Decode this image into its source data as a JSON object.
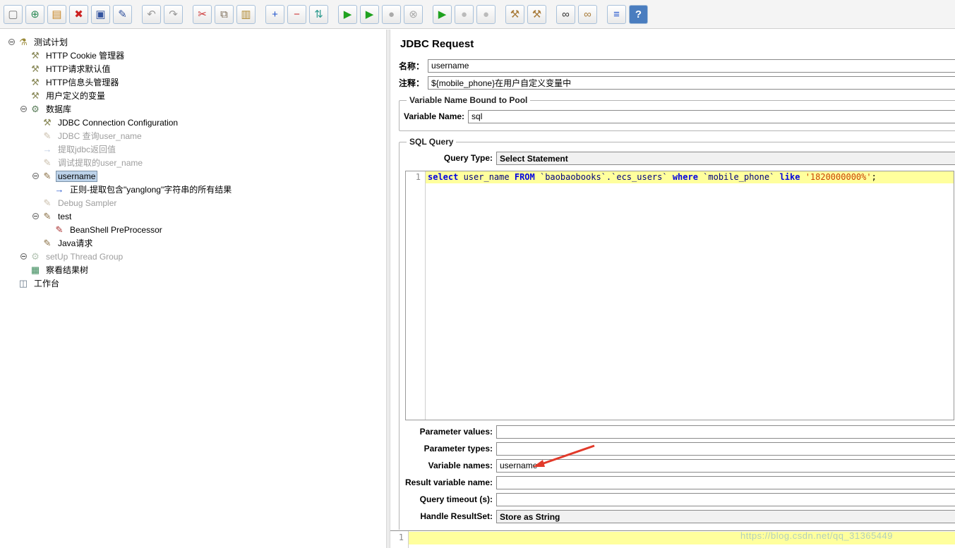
{
  "toolbar": {
    "groups": [
      [
        {
          "name": "new-plan",
          "glyph": "▢",
          "fg": "#777777"
        },
        {
          "name": "templates",
          "glyph": "⊕",
          "fg": "#2e8b57"
        },
        {
          "name": "open-file",
          "glyph": "▤",
          "fg": "#c8882a"
        },
        {
          "name": "close-plan",
          "glyph": "✖",
          "fg": "#cc2222"
        },
        {
          "name": "save",
          "glyph": "▣",
          "fg": "#33539e"
        },
        {
          "name": "save-as",
          "glyph": "✎",
          "fg": "#33539e"
        }
      ],
      [
        {
          "name": "undo",
          "glyph": "↶",
          "fg": "#999999"
        },
        {
          "name": "redo",
          "glyph": "↷",
          "fg": "#999999"
        }
      ],
      [
        {
          "name": "cut",
          "glyph": "✂",
          "fg": "#cc3333"
        },
        {
          "name": "copy",
          "glyph": "⧉",
          "fg": "#7a6a55"
        },
        {
          "name": "paste",
          "glyph": "▥",
          "fg": "#b08830"
        }
      ],
      [
        {
          "name": "expand-all",
          "glyph": "+",
          "fg": "#2255cc"
        },
        {
          "name": "collapse-all",
          "glyph": "−",
          "fg": "#cc3333"
        },
        {
          "name": "toggle-enable",
          "glyph": "⇅",
          "fg": "#2e9b8f"
        }
      ],
      [
        {
          "name": "start",
          "glyph": "▶",
          "fg": "#1fa21f"
        },
        {
          "name": "start-no-pauses",
          "glyph": "▶",
          "fg": "#1fa21f"
        },
        {
          "name": "stop",
          "glyph": "●",
          "fg": "#aaaaaa"
        },
        {
          "name": "shutdown",
          "glyph": "⊗",
          "fg": "#aaaaaa"
        }
      ],
      [
        {
          "name": "remote-start-all",
          "glyph": "▶",
          "fg": "#1fa21f"
        },
        {
          "name": "remote-stop-all",
          "glyph": "●",
          "fg": "#bbbbbb"
        },
        {
          "name": "remote-shutdown-all",
          "glyph": "●",
          "fg": "#bbbbbb"
        }
      ],
      [
        {
          "name": "clear",
          "glyph": "⚒",
          "fg": "#a87b3a"
        },
        {
          "name": "clear-all",
          "glyph": "⚒",
          "fg": "#a87b3a"
        }
      ],
      [
        {
          "name": "search",
          "glyph": "∞",
          "fg": "#333333"
        },
        {
          "name": "search-reset",
          "glyph": "∞",
          "fg": "#a87b3a"
        }
      ],
      [
        {
          "name": "function-helper",
          "glyph": "≡",
          "fg": "#2255cc"
        },
        {
          "name": "help",
          "glyph": "?",
          "fg": "#ffffff",
          "bg": "#4a7dbf"
        }
      ]
    ]
  },
  "tree": {
    "icon_glyphs": {
      "testplan": "⚗",
      "wrench": "⚒",
      "gear": "⚙",
      "sampler": "✎",
      "extractor": "→",
      "regex": "→",
      "beanshell": "✎",
      "listener": "▦",
      "workbench": "◫"
    },
    "icon_colors": {
      "testplan": "#9a8a3a",
      "wrench": "#8a8a5a",
      "gear": "#5a7d5a",
      "sampler": "#8a7045",
      "extractor": "#6688bb",
      "regex": "#2255cc",
      "beanshell": "#aa3333",
      "listener": "#3a8a5a",
      "workbench": "#667788"
    },
    "items": [
      {
        "label": "测试计划",
        "level": 0,
        "icon": "testplan",
        "handle": true
      },
      {
        "label": "HTTP Cookie 管理器",
        "level": 1,
        "icon": "wrench"
      },
      {
        "label": "HTTP请求默认值",
        "level": 1,
        "icon": "wrench"
      },
      {
        "label": "HTTP信息头管理器",
        "level": 1,
        "icon": "wrench"
      },
      {
        "label": "用户定义的变量",
        "level": 1,
        "icon": "wrench"
      },
      {
        "label": "数据库",
        "level": 1,
        "icon": "gear",
        "handle": true
      },
      {
        "label": "JDBC Connection Configuration",
        "level": 2,
        "icon": "wrench"
      },
      {
        "label": "JDBC 查询user_name",
        "level": 2,
        "icon": "sampler",
        "disabled": true
      },
      {
        "label": "提取jdbc返回值",
        "level": 2,
        "icon": "extractor",
        "disabled": true
      },
      {
        "label": "调试提取的user_name",
        "level": 2,
        "icon": "sampler",
        "disabled": true
      },
      {
        "label": "username",
        "level": 2,
        "icon": "sampler",
        "handle": true,
        "selected": true
      },
      {
        "label": "正则-提取包含\"yanglong\"字符串的所有结果",
        "level": 3,
        "icon": "regex"
      },
      {
        "label": "Debug Sampler",
        "level": 2,
        "icon": "sampler",
        "disabled": true
      },
      {
        "label": "test",
        "level": 2,
        "icon": "sampler",
        "handle": true
      },
      {
        "label": "BeanShell PreProcessor",
        "level": 3,
        "icon": "beanshell"
      },
      {
        "label": "Java请求",
        "level": 2,
        "icon": "sampler"
      },
      {
        "label": "setUp Thread Group",
        "level": 1,
        "icon": "gear",
        "disabled": true,
        "handle": true
      },
      {
        "label": "察看结果树",
        "level": 1,
        "icon": "listener"
      },
      {
        "label": "工作台",
        "level": 0,
        "icon": "workbench"
      }
    ]
  },
  "main": {
    "title": "JDBC Request",
    "form": {
      "name_label": "名称：",
      "name_value": "username",
      "comment_label": "注释：",
      "comment_value": "${mobile_phone}在用户自定义变量中",
      "pool_group_title": "Variable Name Bound to Pool",
      "pool_var_label": "Variable Name:",
      "pool_var_value": "sql",
      "sql_group_title": "SQL Query",
      "query_type_label": "Query Type:",
      "query_type_value": "Select Statement",
      "param_values_label": "Parameter values:",
      "param_values_value": "",
      "param_types_label": "Parameter types:",
      "param_types_value": "",
      "variable_names_label": "Variable names:",
      "variable_names_value": "username",
      "result_variable_label": "Result variable name:",
      "result_variable_value": "",
      "query_timeout_label": "Query timeout (s):",
      "query_timeout_value": "",
      "handle_resultset_label": "Handle ResultSet:",
      "handle_resultset_value": "Store as String"
    }
  },
  "sql_editor": {
    "line_number": "1",
    "tokens": [
      {
        "t": "select",
        "c": "kw"
      },
      {
        "t": " user_name ",
        "c": "id"
      },
      {
        "t": "FROM",
        "c": "kw"
      },
      {
        "t": " `baobaobooks`.`ecs_users` ",
        "c": "id"
      },
      {
        "t": "where",
        "c": "kw"
      },
      {
        "t": " `mobile_phone` ",
        "c": "id"
      },
      {
        "t": "like",
        "c": "kw"
      },
      {
        "t": " ",
        "c": "id"
      },
      {
        "t": "'1820000000%'",
        "c": "str"
      },
      {
        "t": ";",
        "c": "plain"
      }
    ]
  },
  "bottom_editor": {
    "line_number": "1"
  },
  "watermark_text": "https://blog.csdn.net/qq_31365449"
}
